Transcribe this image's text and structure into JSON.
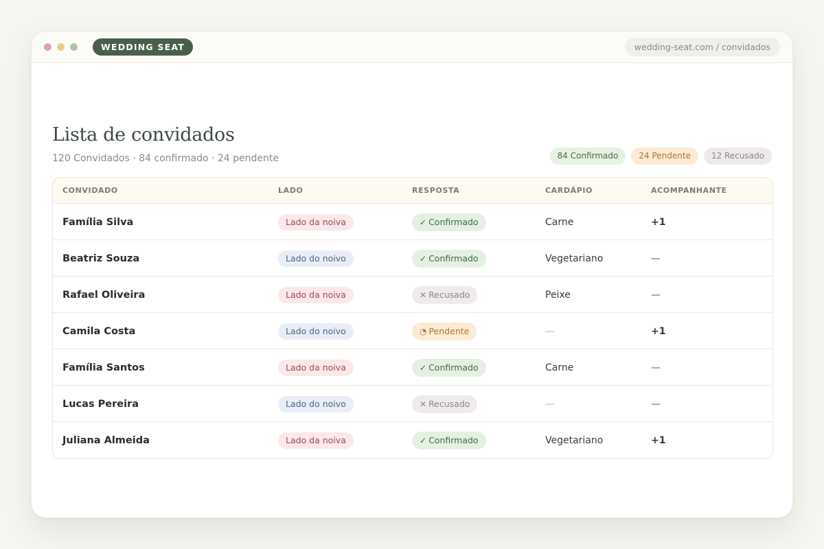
{
  "app": {
    "brand": "WEDDING SEAT",
    "url": "wedding-seat.com / convidados"
  },
  "page": {
    "title": "Lista de convidados",
    "subtitle": "120 Convidados · 84 confirmado · 24 pendente"
  },
  "summary": {
    "confirmed": "84 Confirmado",
    "pending": "24 Pendente",
    "declined": "12 Recusado"
  },
  "table": {
    "headers": [
      "CONVIDADO",
      "LADO",
      "RESPOSTA",
      "CARDÁPIO",
      "ACOMPANHANTE"
    ],
    "rows": [
      {
        "guest": "Família Silva",
        "side": "Lado da noiva",
        "side_key": "noiva",
        "response": "Confirmado",
        "response_key": "confirmado",
        "response_icon": "✓",
        "menu": "Carne",
        "companion": "+1"
      },
      {
        "guest": "Beatriz Souza",
        "side": "Lado do noivo",
        "side_key": "noivo",
        "response": "Confirmado",
        "response_key": "confirmado",
        "response_icon": "✓",
        "menu": "Vegetariano",
        "companion": "—"
      },
      {
        "guest": "Rafael Oliveira",
        "side": "Lado da noiva",
        "side_key": "noiva",
        "response": "Recusado",
        "response_key": "recusado",
        "response_icon": "✕",
        "menu": "Peixe",
        "companion": "—"
      },
      {
        "guest": "Camila Costa",
        "side": "Lado do noivo",
        "side_key": "noivo",
        "response": "Pendente",
        "response_key": "pendente",
        "response_icon": "◔",
        "menu": "—",
        "companion": "+1"
      },
      {
        "guest": "Família Santos",
        "side": "Lado da noiva",
        "side_key": "noiva",
        "response": "Confirmado",
        "response_key": "confirmado",
        "response_icon": "✓",
        "menu": "Carne",
        "companion": "—"
      },
      {
        "guest": "Lucas Pereira",
        "side": "Lado do noivo",
        "side_key": "noivo",
        "response": "Recusado",
        "response_key": "recusado",
        "response_icon": "✕",
        "menu": "—",
        "companion": "—"
      },
      {
        "guest": "Juliana Almeida",
        "side": "Lado da noiva",
        "side_key": "noiva",
        "response": "Confirmado",
        "response_key": "confirmado",
        "response_icon": "✓",
        "menu": "Vegetariano",
        "companion": "+1"
      }
    ]
  },
  "colors": {
    "brand": "#4a5e4c",
    "confirmed": "#3f6b3b",
    "pending": "#b4752a",
    "declined": "#8d8686",
    "bride_side": "#a3485a",
    "groom_side": "#4d6485"
  }
}
